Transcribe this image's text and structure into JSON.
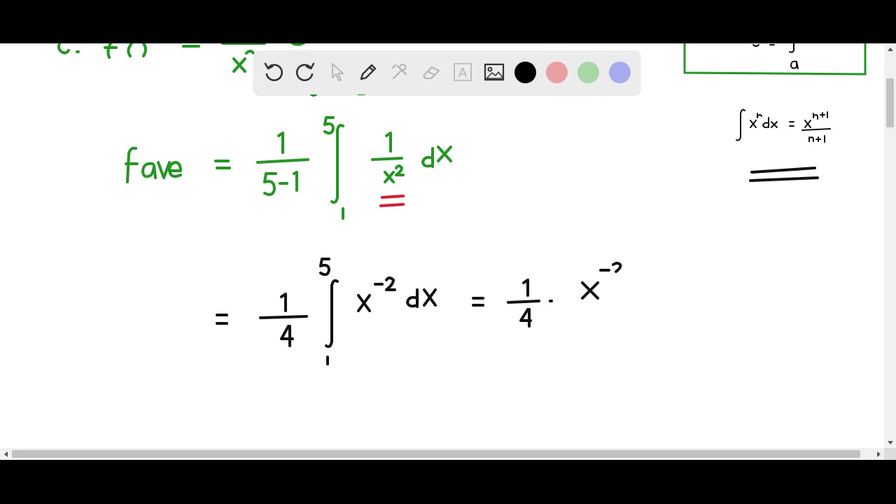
{
  "toolbar": {
    "tools": [
      "undo-icon",
      "redo-icon",
      "pointer-icon",
      "pen-icon",
      "tools-icon",
      "eraser-icon",
      "text-icon",
      "image-icon"
    ],
    "text_tool_glyph": "A",
    "colors": {
      "black": "#000000",
      "red": "#e8a0a3",
      "green": "#a8d8a8",
      "blue": "#a8aaf0"
    }
  },
  "ink_colors": {
    "green": "#1f9a1f",
    "black": "#111111",
    "red": "#e0162b"
  }
}
